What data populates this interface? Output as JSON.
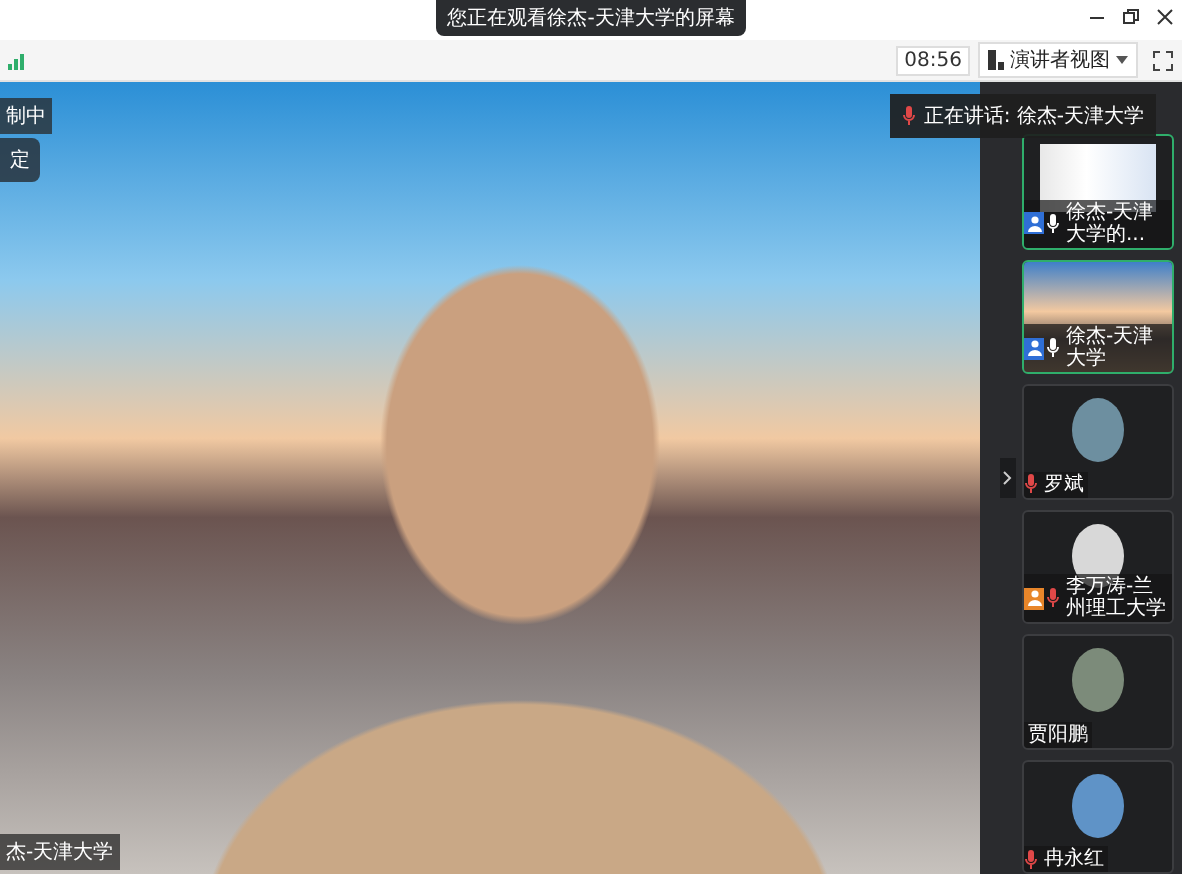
{
  "title_bar": {
    "banner": "您正在观看徐杰-天津大学的屏幕"
  },
  "toolbar": {
    "timer": "08:56",
    "view_button": "演讲者视图"
  },
  "main_video": {
    "status_text": "制中",
    "lock_button": "定",
    "speaker_name": "杰-天津大学"
  },
  "speaking_banner": {
    "text": "正在讲话: 徐杰-天津大学"
  },
  "participants": [
    {
      "name": "徐杰-天津大学的...",
      "kind": "screen",
      "host": true,
      "cohost": false,
      "mic_shown": true,
      "muted": false,
      "highlighted": true
    },
    {
      "name": "徐杰-天津大学",
      "kind": "camera",
      "host": true,
      "cohost": false,
      "mic_shown": true,
      "muted": false,
      "highlighted": true
    },
    {
      "name": "罗斌",
      "kind": "avatar",
      "host": false,
      "cohost": false,
      "mic_shown": true,
      "muted": true,
      "highlighted": false
    },
    {
      "name": "李万涛-兰州理工大学",
      "kind": "avatar",
      "host": false,
      "cohost": true,
      "mic_shown": true,
      "muted": true,
      "highlighted": false
    },
    {
      "name": "贾阳鹏",
      "kind": "avatar",
      "host": false,
      "cohost": false,
      "mic_shown": false,
      "highlighted": false
    },
    {
      "name": "冉永红",
      "kind": "avatar",
      "host": false,
      "cohost": false,
      "mic_shown": true,
      "muted": true,
      "highlighted": false
    }
  ]
}
